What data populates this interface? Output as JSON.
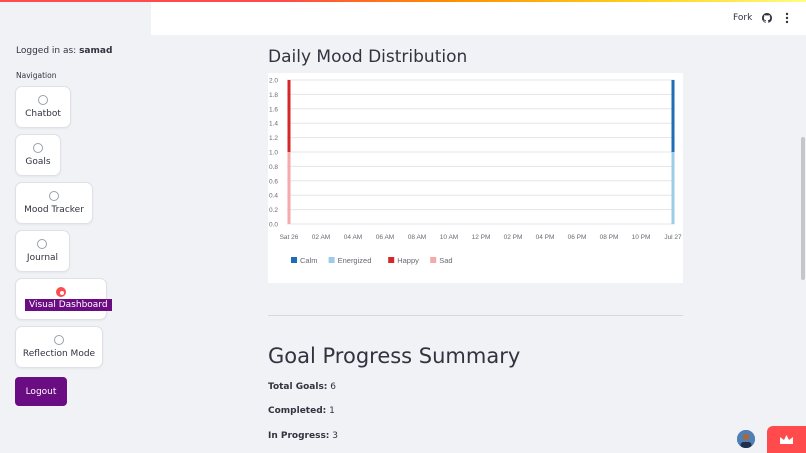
{
  "sidebar": {
    "logged_in_prefix": "Logged in as: ",
    "username": "samad",
    "nav_label": "Navigation",
    "nav_items": [
      {
        "label": "Chatbot",
        "selected": false
      },
      {
        "label": "Goals",
        "selected": false
      },
      {
        "label": "Mood Tracker",
        "selected": false
      },
      {
        "label": "Journal",
        "selected": false
      },
      {
        "label": "Visual Dashboard",
        "selected": true
      },
      {
        "label": "Reflection Mode",
        "selected": false
      }
    ],
    "logout_label": "Logout"
  },
  "header": {
    "fork_label": "Fork",
    "github_icon": "github-icon",
    "menu_icon": "kebab-menu-icon"
  },
  "main": {
    "chart_title": "Daily Mood Distribution",
    "summary_title": "Goal Progress Summary",
    "stats": [
      {
        "label": "Total Goals:",
        "value": "6"
      },
      {
        "label": "Completed:",
        "value": "1"
      },
      {
        "label": "In Progress:",
        "value": "3"
      }
    ]
  },
  "colors": {
    "accent": "#6a0d83",
    "radio_selected": "#ff4b4b",
    "calm": "#1f6eb5",
    "energized": "#9ecbe8",
    "happy": "#d62728",
    "sad": "#f4a9ab"
  },
  "chart_data": {
    "type": "bar",
    "stacked": true,
    "y_ticks": [
      "0.0",
      "0.2",
      "0.4",
      "0.6",
      "0.8",
      "1.0",
      "1.2",
      "1.4",
      "1.6",
      "1.8",
      "2.0"
    ],
    "ylim": [
      0,
      2
    ],
    "x_ticks": [
      "Sat 26",
      "02 AM",
      "04 AM",
      "06 AM",
      "08 AM",
      "10 AM",
      "12 PM",
      "02 PM",
      "04 PM",
      "06 PM",
      "08 PM",
      "10 PM",
      "Jul 27"
    ],
    "legend_position": "bottom-left",
    "grid": true,
    "series": [
      {
        "name": "Calm",
        "color": "#1f6eb5",
        "values": [
          0,
          1
        ]
      },
      {
        "name": "Energized",
        "color": "#9ecbe8",
        "values": [
          0,
          1
        ]
      },
      {
        "name": "Happy",
        "color": "#d62728",
        "values": [
          1,
          0
        ]
      },
      {
        "name": "Sad",
        "color": "#f4a9ab",
        "values": [
          1,
          0
        ]
      }
    ],
    "x_positions": [
      "Sat 26",
      "Jul 27"
    ]
  }
}
